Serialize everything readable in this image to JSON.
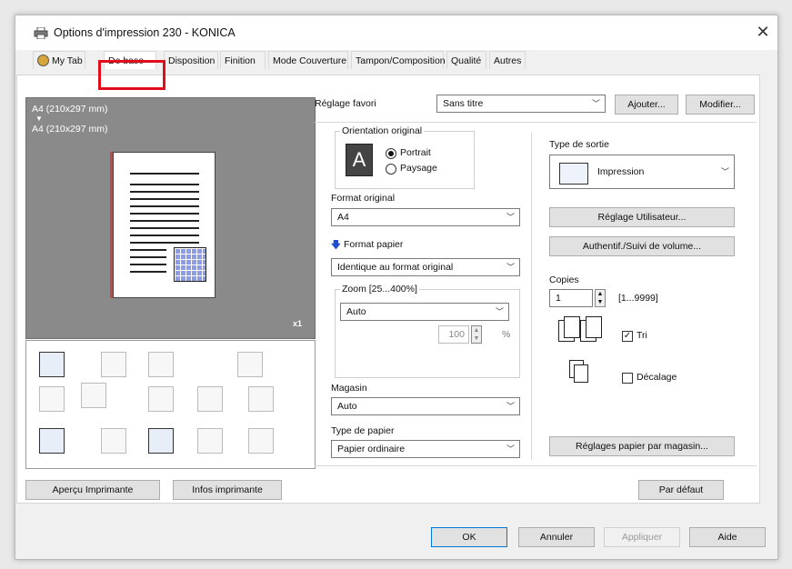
{
  "window": {
    "title": "Options d'impression 230 - KONICA",
    "close": "✕"
  },
  "tabs": [
    {
      "label": "My Tab"
    },
    {
      "label": "De base"
    },
    {
      "label": "Disposition"
    },
    {
      "label": "Finition"
    },
    {
      "label": "Mode Couverture"
    },
    {
      "label": "Tampon/Composition"
    },
    {
      "label": "Qualité"
    },
    {
      "label": "Autres"
    }
  ],
  "preview": {
    "size_top": "A4 (210x297 mm)",
    "arrow": "▼",
    "size_bottom": "A4 (210x297 mm)",
    "copies_badge": "x1"
  },
  "left_buttons": {
    "apercu": "Aperçu Imprimante",
    "infos": "Infos imprimante"
  },
  "favorites": {
    "label": "Réglage favori",
    "value": "Sans titre",
    "add": "Ajouter...",
    "modify": "Modifier..."
  },
  "orientation": {
    "group_label": "Orientation original",
    "portrait": "Portrait",
    "landscape": "Paysage",
    "selected": "Portrait",
    "icon": "A"
  },
  "format_original": {
    "label": "Format original",
    "value": "A4"
  },
  "format_papier": {
    "label": "Format papier",
    "value": "Identique au format original"
  },
  "zoom": {
    "label": "Zoom [25...400%]",
    "value": "Auto",
    "percent_value": "100",
    "percent_unit": "%"
  },
  "magasin": {
    "label": "Magasin",
    "value": "Auto"
  },
  "type_papier": {
    "label": "Type de papier",
    "value": "Papier ordinaire"
  },
  "sortie": {
    "label": "Type de sortie",
    "value": "Impression"
  },
  "user_buttons": {
    "reglage_utilisateur": "Réglage Utilisateur...",
    "authentif": "Authentif./Suivi de volume..."
  },
  "copies": {
    "label": "Copies",
    "value": "1",
    "range": "[1...9999]"
  },
  "tri": {
    "label": "Tri",
    "checked": true
  },
  "decalage": {
    "label": "Décalage",
    "checked": false
  },
  "reglages_magasin": "Réglages papier par magasin...",
  "par_defaut": "Par défaut",
  "footer": {
    "ok": "OK",
    "annuler": "Annuler",
    "appliquer": "Appliquer",
    "aide": "Aide"
  }
}
